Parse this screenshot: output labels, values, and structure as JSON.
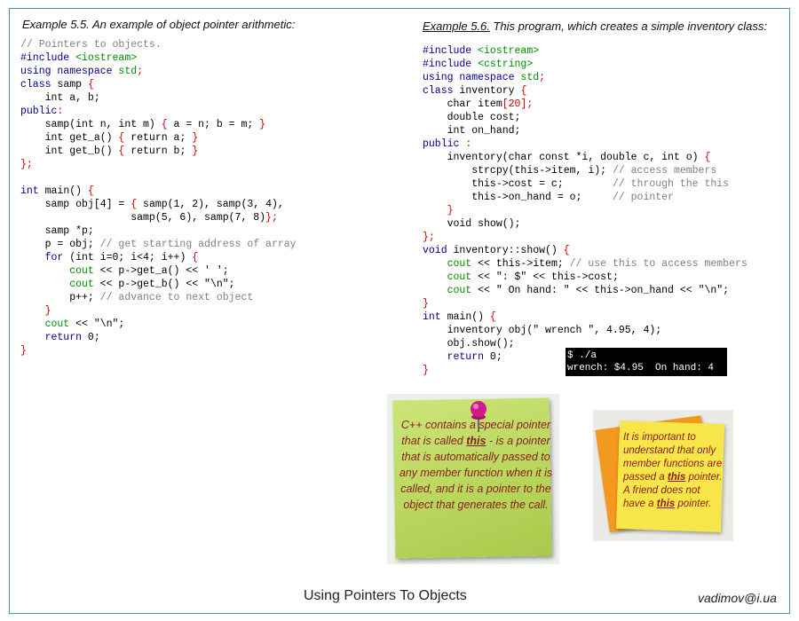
{
  "left": {
    "caption": "Example 5.5. An example of object pointer arithmetic:",
    "code": [
      [
        [
          "c",
          "// Pointers to objects."
        ]
      ],
      [
        [
          "k",
          "#include "
        ],
        [
          "s",
          "<iostream>"
        ]
      ],
      [
        [
          "k",
          "using namespace "
        ],
        [
          "s",
          "std"
        ],
        [
          "r",
          ";"
        ]
      ],
      [
        [
          "k",
          "class "
        ],
        [
          "",
          "samp "
        ],
        [
          "r",
          "{"
        ]
      ],
      [
        [
          "",
          "    int a, b;"
        ]
      ],
      [
        [
          "k",
          "public"
        ],
        [
          "r",
          ":"
        ]
      ],
      [
        [
          "",
          "    samp(int n, int m) "
        ],
        [
          "r",
          "{"
        ],
        [
          "",
          " a = n; b = m; "
        ],
        [
          "r",
          "}"
        ]
      ],
      [
        [
          "",
          "    int get_a() "
        ],
        [
          "r",
          "{"
        ],
        [
          "",
          " return a; "
        ],
        [
          "r",
          "}"
        ]
      ],
      [
        [
          "",
          "    int get_b() "
        ],
        [
          "r",
          "{"
        ],
        [
          "",
          " return b; "
        ],
        [
          "r",
          "}"
        ]
      ],
      [
        [
          "r",
          "};"
        ]
      ],
      [
        [
          "",
          ""
        ]
      ],
      [
        [
          "k",
          "int "
        ],
        [
          "",
          "main() "
        ],
        [
          "r",
          "{"
        ]
      ],
      [
        [
          "",
          "    samp obj[4] = "
        ],
        [
          "r",
          "{"
        ],
        [
          "",
          " samp(1, 2), samp(3, 4),"
        ]
      ],
      [
        [
          "",
          "                  samp(5, 6), samp(7, 8)"
        ],
        [
          "r",
          "};"
        ]
      ],
      [
        [
          "",
          "    samp *p;"
        ]
      ],
      [
        [
          "",
          "    p = obj; "
        ],
        [
          "c",
          "// get starting address of array"
        ]
      ],
      [
        [
          "k",
          "    for "
        ],
        [
          "",
          "(int i=0; i<4; i++) "
        ],
        [
          "r",
          "{"
        ]
      ],
      [
        [
          "s",
          "        cout "
        ],
        [
          "",
          "<< p->get_a() << ' ';"
        ]
      ],
      [
        [
          "s",
          "        cout "
        ],
        [
          "",
          "<< p->get_b() << \"\\n\";"
        ]
      ],
      [
        [
          "",
          "        p++; "
        ],
        [
          "c",
          "// advance to next object"
        ]
      ],
      [
        [
          "r",
          "    }"
        ]
      ],
      [
        [
          "s",
          "    cout "
        ],
        [
          "",
          "<< \"\\n\";"
        ]
      ],
      [
        [
          "k",
          "    return "
        ],
        [
          "",
          "0;"
        ]
      ],
      [
        [
          "r",
          "}"
        ]
      ]
    ]
  },
  "right": {
    "caption_label": "Example 5.6.",
    "caption_text": " This  program, which creates a simple inventory class:",
    "code": [
      [
        [
          "k",
          "#include "
        ],
        [
          "s",
          "<iostream>"
        ]
      ],
      [
        [
          "k",
          "#include "
        ],
        [
          "s",
          "<cstring>"
        ]
      ],
      [
        [
          "k",
          "using namespace "
        ],
        [
          "s",
          "std"
        ],
        [
          "r",
          ";"
        ]
      ],
      [
        [
          "k",
          "class "
        ],
        [
          "",
          "inventory "
        ],
        [
          "r",
          "{"
        ]
      ],
      [
        [
          "",
          "    char item"
        ],
        [
          "r",
          "[20];"
        ]
      ],
      [
        [
          "",
          "    double cost;"
        ]
      ],
      [
        [
          "",
          "    int on_hand;"
        ]
      ],
      [
        [
          "k",
          "public "
        ],
        [
          "r",
          ":"
        ]
      ],
      [
        [
          "",
          "    inventory(char const *i, double c, int o) "
        ],
        [
          "r",
          "{"
        ]
      ],
      [
        [
          "",
          "        strcpy(this->item, i); "
        ],
        [
          "c",
          "// access members"
        ]
      ],
      [
        [
          "",
          "        this->cost = c;        "
        ],
        [
          "c",
          "// through the this"
        ]
      ],
      [
        [
          "",
          "        this->on_hand = o;     "
        ],
        [
          "c",
          "// pointer"
        ]
      ],
      [
        [
          "r",
          "    }"
        ]
      ],
      [
        [
          "",
          "    void show();"
        ]
      ],
      [
        [
          "r",
          "};"
        ]
      ],
      [
        [
          "k",
          "void "
        ],
        [
          "",
          "inventory::show() "
        ],
        [
          "r",
          "{"
        ]
      ],
      [
        [
          "s",
          "    cout "
        ],
        [
          "",
          "<< this->item; "
        ],
        [
          "c",
          "// use this to access members"
        ]
      ],
      [
        [
          "s",
          "    cout "
        ],
        [
          "",
          "<< \": $\" << this->cost;"
        ]
      ],
      [
        [
          "s",
          "    cout "
        ],
        [
          "",
          "<< \" On hand: \" << this->on_hand << \"\\n\";"
        ]
      ],
      [
        [
          "r",
          "}"
        ]
      ],
      [
        [
          "k",
          "int "
        ],
        [
          "",
          "main() "
        ],
        [
          "r",
          "{"
        ]
      ],
      [
        [
          "",
          "    inventory obj(\" wrench \", 4.95, 4);"
        ]
      ],
      [
        [
          "",
          "    obj.show();"
        ]
      ],
      [
        [
          "k",
          "    return "
        ],
        [
          "",
          "0;"
        ]
      ],
      [
        [
          "r",
          "}"
        ]
      ]
    ]
  },
  "console": {
    "line1": "$ ./a",
    "line2": "wrench: $4.95  On hand: 4"
  },
  "note_green": {
    "parts": [
      {
        "t": "C++ contains a special pointer that is called ",
        "b": false
      },
      {
        "t": "this",
        "b": true
      },
      {
        "t": " -  is a pointer that is automatically passed to any member function when it is called, and it is a pointer to the object that generates the call.",
        "b": false
      }
    ]
  },
  "note_yellow": {
    "parts": [
      {
        "t": "It is important to understand that only member functions are passed a ",
        "b": false
      },
      {
        "t": "this",
        "b": true
      },
      {
        "t": " pointer. A friend does not have a ",
        "b": false
      },
      {
        "t": "this",
        "b": true
      },
      {
        "t": " pointer.",
        "b": false
      }
    ]
  },
  "footer": {
    "title": "Using Pointers To Objects",
    "email": "vadimov@i.ua"
  },
  "colors": {
    "frame": "#4a9a93",
    "keyword": "#00008b",
    "string": "#008b00",
    "punct": "#cc0000",
    "comment": "#808080",
    "note_text": "#8b1a1a",
    "green_note": "#b7d55a",
    "yellow_note": "#f7e64a",
    "orange_note": "#f39a1e",
    "pin": "#d01a8e"
  }
}
